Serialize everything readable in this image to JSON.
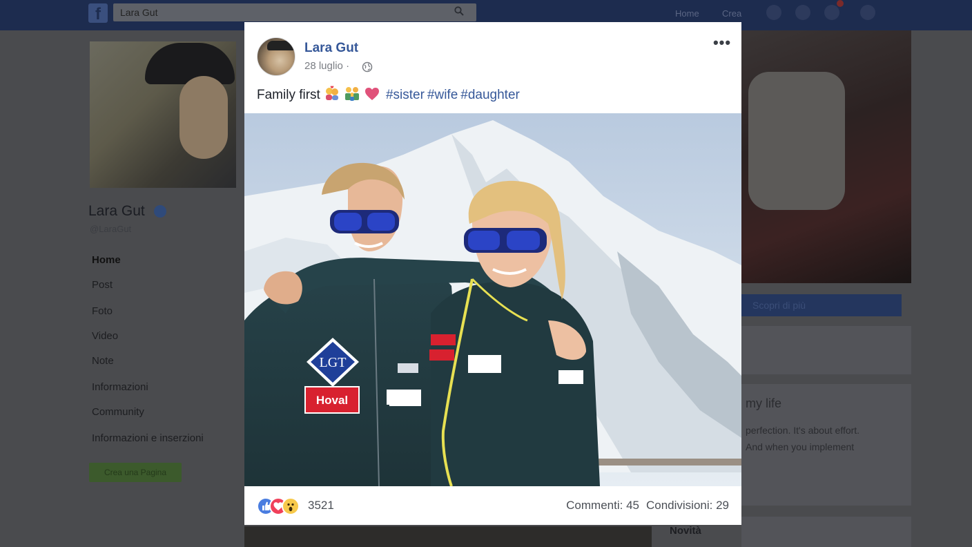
{
  "topbar": {
    "search_value": "Lara Gut",
    "links": [
      "Home",
      "Crea"
    ]
  },
  "profile": {
    "name": "Lara Gut",
    "handle": "@LaraGut",
    "nav": [
      "Home",
      "Post",
      "Foto",
      "Video",
      "Note",
      "Informazioni",
      "Community",
      "Informazioni e inserzioni"
    ],
    "action_button": "Crea una Pagina"
  },
  "right_column": {
    "discover_button": "Scopri di più",
    "card_title": "my life",
    "card_lines": [
      "perfection. It's about effort.",
      "And when you implement"
    ],
    "news_label": "Novità"
  },
  "post": {
    "author": "Lara Gut",
    "date": "28 luglio",
    "date_separator": "·",
    "more_label": "•••",
    "text_plain": "Family first",
    "hashtags": [
      "#sister",
      "#wife",
      "#daughter"
    ],
    "reaction_count": "3521",
    "comments": "Commenti: 45",
    "shares": "Condivisioni: 29",
    "photo_badges": [
      "LGT",
      "Hoval"
    ]
  },
  "colors": {
    "link_blue": "#365899",
    "topbar": "#1d2c4f",
    "like": "#4a7de0",
    "love": "#f0405a",
    "wow": "#f7c94b"
  }
}
